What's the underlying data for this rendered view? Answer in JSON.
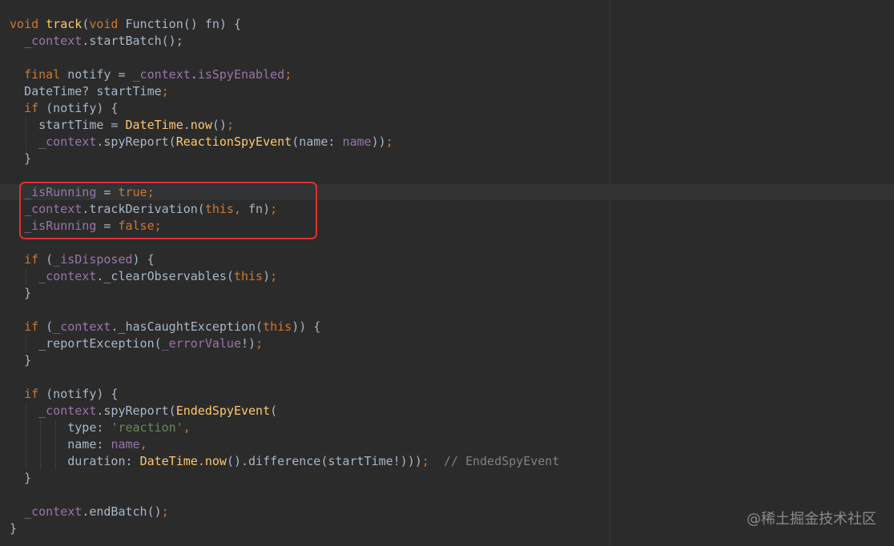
{
  "editor": {
    "colors": {
      "background": "#2b2b2b",
      "keyword": "#cc7832",
      "function": "#ffc66d",
      "field": "#9876aa",
      "string": "#6a8759",
      "comment": "#808080",
      "plain": "#a9b7c6",
      "highlight_box": "#e0312f"
    },
    "lines": [
      {
        "indent": 0,
        "tokens": [
          [
            "keyword",
            "void "
          ],
          [
            "function",
            "track"
          ],
          [
            "plain",
            "("
          ],
          [
            "keyword",
            "void "
          ],
          [
            "plain",
            "Function() fn) {"
          ]
        ]
      },
      {
        "indent": 1,
        "tokens": [
          [
            "field",
            "_context"
          ],
          [
            "plain",
            ".startBatch();"
          ]
        ]
      },
      {
        "indent": 0,
        "tokens": []
      },
      {
        "indent": 1,
        "tokens": [
          [
            "keyword",
            "final "
          ],
          [
            "plain",
            "notify = "
          ],
          [
            "field",
            "_context"
          ],
          [
            "plain",
            "."
          ],
          [
            "field",
            "isSpyEnabled"
          ],
          [
            "keyword",
            ";"
          ]
        ]
      },
      {
        "indent": 1,
        "tokens": [
          [
            "plain",
            "DateTime? startTime"
          ],
          [
            "keyword",
            ";"
          ]
        ]
      },
      {
        "indent": 1,
        "tokens": [
          [
            "keyword",
            "if "
          ],
          [
            "plain",
            "(notify) {"
          ]
        ]
      },
      {
        "indent": 2,
        "tokens": [
          [
            "plain",
            "startTime = "
          ],
          [
            "function",
            "DateTime"
          ],
          [
            "plain",
            "."
          ],
          [
            "function",
            "now"
          ],
          [
            "plain",
            "()"
          ],
          [
            "keyword",
            ";"
          ]
        ]
      },
      {
        "indent": 2,
        "tokens": [
          [
            "field",
            "_context"
          ],
          [
            "plain",
            ".spyReport("
          ],
          [
            "function",
            "ReactionSpyEvent"
          ],
          [
            "plain",
            "(name: "
          ],
          [
            "field",
            "name"
          ],
          [
            "plain",
            "))"
          ],
          [
            "keyword",
            ";"
          ]
        ]
      },
      {
        "indent": 1,
        "tokens": [
          [
            "plain",
            "}"
          ]
        ]
      },
      {
        "indent": 0,
        "tokens": []
      },
      {
        "indent": 1,
        "tokens": [
          [
            "field",
            "_isRunning"
          ],
          [
            "plain",
            " = "
          ],
          [
            "keyword",
            "true;"
          ]
        ]
      },
      {
        "indent": 1,
        "tokens": [
          [
            "field",
            "_context"
          ],
          [
            "plain",
            ".trackDerivation("
          ],
          [
            "keyword",
            "this, "
          ],
          [
            "plain",
            "fn)"
          ],
          [
            "keyword",
            ";"
          ]
        ]
      },
      {
        "indent": 1,
        "tokens": [
          [
            "field",
            "_isRunning"
          ],
          [
            "plain",
            " = "
          ],
          [
            "keyword",
            "false;"
          ]
        ]
      },
      {
        "indent": 0,
        "tokens": []
      },
      {
        "indent": 1,
        "tokens": [
          [
            "keyword",
            "if "
          ],
          [
            "plain",
            "("
          ],
          [
            "field",
            "_isDisposed"
          ],
          [
            "plain",
            ") {"
          ]
        ]
      },
      {
        "indent": 2,
        "tokens": [
          [
            "field",
            "_context"
          ],
          [
            "plain",
            "._clearObservables("
          ],
          [
            "keyword",
            "this"
          ],
          [
            "plain",
            ")"
          ],
          [
            "keyword",
            ";"
          ]
        ]
      },
      {
        "indent": 1,
        "tokens": [
          [
            "plain",
            "}"
          ]
        ]
      },
      {
        "indent": 0,
        "tokens": []
      },
      {
        "indent": 1,
        "tokens": [
          [
            "keyword",
            "if "
          ],
          [
            "plain",
            "("
          ],
          [
            "field",
            "_context"
          ],
          [
            "plain",
            "._hasCaughtException("
          ],
          [
            "keyword",
            "this"
          ],
          [
            "plain",
            ")) {"
          ]
        ]
      },
      {
        "indent": 2,
        "tokens": [
          [
            "plain",
            "_reportException("
          ],
          [
            "field",
            "_errorValue"
          ],
          [
            "plain",
            "!)"
          ],
          [
            "keyword",
            ";"
          ]
        ]
      },
      {
        "indent": 1,
        "tokens": [
          [
            "plain",
            "}"
          ]
        ]
      },
      {
        "indent": 0,
        "tokens": []
      },
      {
        "indent": 1,
        "tokens": [
          [
            "keyword",
            "if "
          ],
          [
            "plain",
            "(notify) {"
          ]
        ]
      },
      {
        "indent": 2,
        "tokens": [
          [
            "field",
            "_context"
          ],
          [
            "plain",
            ".spyReport("
          ],
          [
            "function",
            "EndedSpyEvent"
          ],
          [
            "plain",
            "("
          ]
        ]
      },
      {
        "indent": 4,
        "tokens": [
          [
            "plain",
            "type: "
          ],
          [
            "string",
            "'reaction'"
          ],
          [
            "keyword",
            ","
          ]
        ]
      },
      {
        "indent": 4,
        "tokens": [
          [
            "plain",
            "name: "
          ],
          [
            "field",
            "name"
          ],
          [
            "keyword",
            ","
          ]
        ]
      },
      {
        "indent": 4,
        "tokens": [
          [
            "plain",
            "duration: "
          ],
          [
            "function",
            "DateTime"
          ],
          [
            "plain",
            "."
          ],
          [
            "function",
            "now"
          ],
          [
            "plain",
            "().difference(startTime!)))"
          ],
          [
            "keyword",
            ";"
          ],
          [
            "plain",
            "  "
          ],
          [
            "comment",
            "// EndedSpyEvent"
          ]
        ]
      },
      {
        "indent": 1,
        "tokens": [
          [
            "plain",
            "}"
          ]
        ]
      },
      {
        "indent": 0,
        "tokens": []
      },
      {
        "indent": 1,
        "tokens": [
          [
            "field",
            "_context"
          ],
          [
            "plain",
            ".endBatch()"
          ],
          [
            "keyword",
            ";"
          ]
        ]
      },
      {
        "indent": 0,
        "tokens": [
          [
            "plain",
            "}"
          ]
        ]
      }
    ]
  },
  "watermark": {
    "text": "@稀土掘金技术社区"
  }
}
